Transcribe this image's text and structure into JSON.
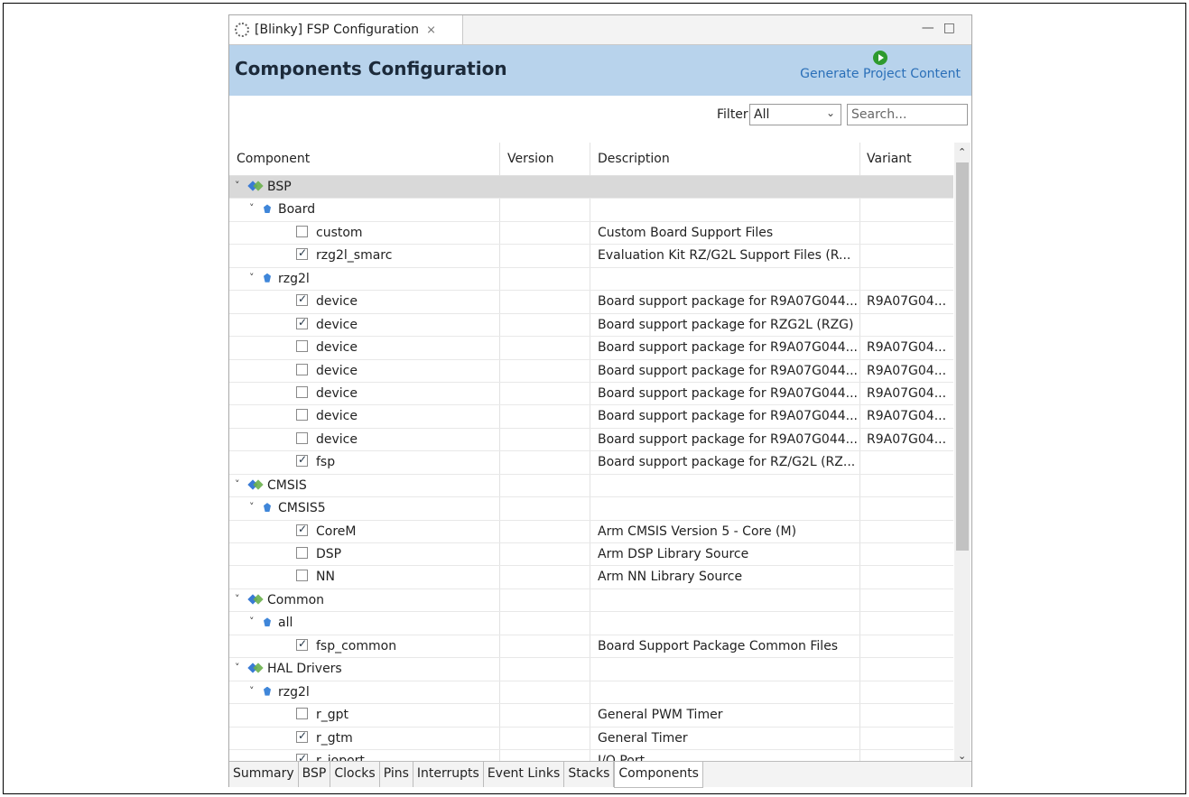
{
  "tab": {
    "title": "[Blinky] FSP Configuration",
    "close": "⨯",
    "icon": "gear-icon"
  },
  "window_controls": {
    "minimize": "—",
    "maximize": "□"
  },
  "header": {
    "title": "Components Configuration",
    "generate_label": "Generate Project Content",
    "generate_icon": "run-icon"
  },
  "filter": {
    "label": "Filter",
    "selected": "All",
    "search_placeholder": "Search..."
  },
  "columns": {
    "component": "Component",
    "version": "Version",
    "description": "Description",
    "variant": "Variant"
  },
  "rows": [
    {
      "level": 0,
      "type": "group",
      "name": "BSP",
      "desc": "",
      "variant": "",
      "selected": true
    },
    {
      "level": 1,
      "type": "sub",
      "name": "Board",
      "desc": "",
      "variant": ""
    },
    {
      "level": 2,
      "type": "item",
      "checked": false,
      "name": "custom",
      "desc": "Custom Board Support Files",
      "variant": ""
    },
    {
      "level": 2,
      "type": "item",
      "checked": true,
      "name": "rzg2l_smarc",
      "desc": "Evaluation Kit RZ/G2L Support Files (R...",
      "variant": ""
    },
    {
      "level": 1,
      "type": "sub",
      "name": "rzg2l",
      "desc": "",
      "variant": ""
    },
    {
      "level": 2,
      "type": "item",
      "checked": true,
      "name": "device",
      "desc": "Board support package for R9A07G044...",
      "variant": "R9A07G04..."
    },
    {
      "level": 2,
      "type": "item",
      "checked": true,
      "name": "device",
      "desc": "Board support package for RZG2L (RZG)",
      "variant": ""
    },
    {
      "level": 2,
      "type": "item",
      "checked": false,
      "name": "device",
      "desc": "Board support package for R9A07G044...",
      "variant": "R9A07G04..."
    },
    {
      "level": 2,
      "type": "item",
      "checked": false,
      "name": "device",
      "desc": "Board support package for R9A07G044...",
      "variant": "R9A07G04..."
    },
    {
      "level": 2,
      "type": "item",
      "checked": false,
      "name": "device",
      "desc": "Board support package for R9A07G044...",
      "variant": "R9A07G04..."
    },
    {
      "level": 2,
      "type": "item",
      "checked": false,
      "name": "device",
      "desc": "Board support package for R9A07G044...",
      "variant": "R9A07G04..."
    },
    {
      "level": 2,
      "type": "item",
      "checked": false,
      "name": "device",
      "desc": "Board support package for R9A07G044...",
      "variant": "R9A07G04..."
    },
    {
      "level": 2,
      "type": "item",
      "checked": true,
      "name": "fsp",
      "desc": "Board support package for RZ/G2L (RZ...",
      "variant": ""
    },
    {
      "level": 0,
      "type": "group",
      "name": "CMSIS",
      "desc": "",
      "variant": ""
    },
    {
      "level": 1,
      "type": "sub",
      "name": "CMSIS5",
      "desc": "",
      "variant": ""
    },
    {
      "level": 2,
      "type": "item",
      "checked": true,
      "name": "CoreM",
      "desc": "Arm CMSIS Version 5 - Core (M)",
      "variant": ""
    },
    {
      "level": 2,
      "type": "item",
      "checked": false,
      "name": "DSP",
      "desc": "Arm DSP Library Source",
      "variant": ""
    },
    {
      "level": 2,
      "type": "item",
      "checked": false,
      "name": "NN",
      "desc": "Arm NN Library Source",
      "variant": ""
    },
    {
      "level": 0,
      "type": "group",
      "name": "Common",
      "desc": "",
      "variant": ""
    },
    {
      "level": 1,
      "type": "sub",
      "name": "all",
      "desc": "",
      "variant": ""
    },
    {
      "level": 2,
      "type": "item",
      "checked": true,
      "name": "fsp_common",
      "desc": "Board Support Package Common Files",
      "variant": ""
    },
    {
      "level": 0,
      "type": "group",
      "name": "HAL Drivers",
      "desc": "",
      "variant": ""
    },
    {
      "level": 1,
      "type": "sub",
      "name": "rzg2l",
      "desc": "",
      "variant": ""
    },
    {
      "level": 2,
      "type": "item",
      "checked": false,
      "name": "r_gpt",
      "desc": "General PWM Timer",
      "variant": ""
    },
    {
      "level": 2,
      "type": "item",
      "checked": true,
      "name": "r_gtm",
      "desc": "General Timer",
      "variant": ""
    },
    {
      "level": 2,
      "type": "item",
      "checked": true,
      "name": "r_ioport",
      "desc": "I/O Port",
      "variant": ""
    }
  ],
  "bottom_tabs": [
    "Summary",
    "BSP",
    "Clocks",
    "Pins",
    "Interrupts",
    "Event Links",
    "Stacks",
    "Components"
  ],
  "active_bottom_tab": "Components"
}
